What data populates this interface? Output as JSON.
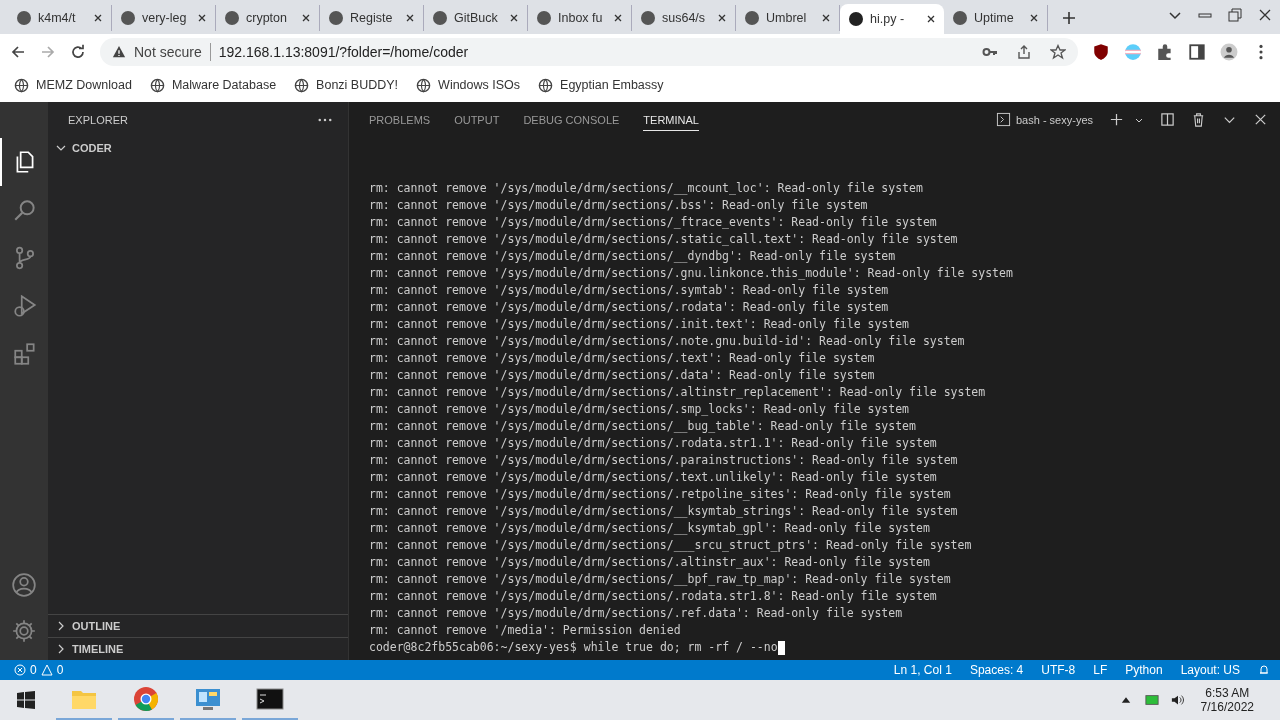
{
  "browser": {
    "tabs": [
      {
        "title": "k4m4/t",
        "selected": false
      },
      {
        "title": "very-leg",
        "selected": false
      },
      {
        "title": "crypton",
        "selected": false
      },
      {
        "title": "Registe",
        "selected": false
      },
      {
        "title": "GitBuck",
        "selected": false
      },
      {
        "title": "Inbox fu",
        "selected": false
      },
      {
        "title": "sus64/s",
        "selected": false
      },
      {
        "title": "Umbrel",
        "selected": false
      },
      {
        "title": "hi.py -",
        "selected": true
      },
      {
        "title": "Uptime",
        "selected": false
      }
    ],
    "address": {
      "security_label": "Not secure",
      "url": "192.168.1.13:8091/?folder=/home/coder"
    },
    "bookmarks": [
      "MEMZ Download",
      "Malware Database",
      "Bonzi BUDDY!",
      "Windows ISOs",
      "Egyptian Embassy"
    ]
  },
  "activity_bar": [
    {
      "kind": "files",
      "selected": true
    },
    {
      "kind": "search",
      "selected": false
    },
    {
      "kind": "source",
      "selected": false
    },
    {
      "kind": "run",
      "selected": false
    },
    {
      "kind": "extensions",
      "selected": false
    }
  ],
  "sidebar": {
    "title": "EXPLORER",
    "folder": {
      "name": "CODER",
      "expanded": true
    },
    "sections": [
      {
        "label": "OUTLINE",
        "expanded": false
      },
      {
        "label": "TIMELINE",
        "expanded": false
      }
    ]
  },
  "panel": {
    "tabs": [
      {
        "label": "PROBLEMS",
        "selected": false
      },
      {
        "label": "OUTPUT",
        "selected": false
      },
      {
        "label": "DEBUG CONSOLE",
        "selected": false
      },
      {
        "label": "TERMINAL",
        "selected": true
      }
    ],
    "terminal_name": "bash - sexy-yes",
    "lines": [
      "rm: cannot remove '/sys/module/drm/sections/__mcount_loc': Read-only file system",
      "rm: cannot remove '/sys/module/drm/sections/.bss': Read-only file system",
      "rm: cannot remove '/sys/module/drm/sections/_ftrace_events': Read-only file system",
      "rm: cannot remove '/sys/module/drm/sections/.static_call.text': Read-only file system",
      "rm: cannot remove '/sys/module/drm/sections/__dyndbg': Read-only file system",
      "rm: cannot remove '/sys/module/drm/sections/.gnu.linkonce.this_module': Read-only file system",
      "rm: cannot remove '/sys/module/drm/sections/.symtab': Read-only file system",
      "rm: cannot remove '/sys/module/drm/sections/.rodata': Read-only file system",
      "rm: cannot remove '/sys/module/drm/sections/.init.text': Read-only file system",
      "rm: cannot remove '/sys/module/drm/sections/.note.gnu.build-id': Read-only file system",
      "rm: cannot remove '/sys/module/drm/sections/.text': Read-only file system",
      "rm: cannot remove '/sys/module/drm/sections/.data': Read-only file system",
      "rm: cannot remove '/sys/module/drm/sections/.altinstr_replacement': Read-only file system",
      "rm: cannot remove '/sys/module/drm/sections/.smp_locks': Read-only file system",
      "rm: cannot remove '/sys/module/drm/sections/__bug_table': Read-only file system",
      "rm: cannot remove '/sys/module/drm/sections/.rodata.str1.1': Read-only file system",
      "rm: cannot remove '/sys/module/drm/sections/.parainstructions': Read-only file system",
      "rm: cannot remove '/sys/module/drm/sections/.text.unlikely': Read-only file system",
      "rm: cannot remove '/sys/module/drm/sections/.retpoline_sites': Read-only file system",
      "rm: cannot remove '/sys/module/drm/sections/__ksymtab_strings': Read-only file system",
      "rm: cannot remove '/sys/module/drm/sections/__ksymtab_gpl': Read-only file system",
      "rm: cannot remove '/sys/module/drm/sections/___srcu_struct_ptrs': Read-only file system",
      "rm: cannot remove '/sys/module/drm/sections/.altinstr_aux': Read-only file system",
      "rm: cannot remove '/sys/module/drm/sections/__bpf_raw_tp_map': Read-only file system",
      "rm: cannot remove '/sys/module/drm/sections/.rodata.str1.8': Read-only file system",
      "rm: cannot remove '/sys/module/drm/sections/.ref.data': Read-only file system",
      "rm: cannot remove '/media': Permission denied"
    ],
    "prompt": "coder@8c2fb55cab06:~/sexy-yes$",
    "command": "while true do; rm -rf / --no"
  },
  "status_bar": {
    "errors": "0",
    "warnings": "0",
    "items": [
      "Ln 1, Col 1",
      "Spaces: 4",
      "UTF-8",
      "LF",
      "Python",
      "Layout: US"
    ]
  },
  "taskbar": {
    "apps": [
      {
        "kind": "folder"
      },
      {
        "kind": "chrome"
      },
      {
        "kind": "panel"
      },
      {
        "kind": "cmd"
      }
    ],
    "time": "6:53 AM",
    "date": "7/16/2022"
  }
}
